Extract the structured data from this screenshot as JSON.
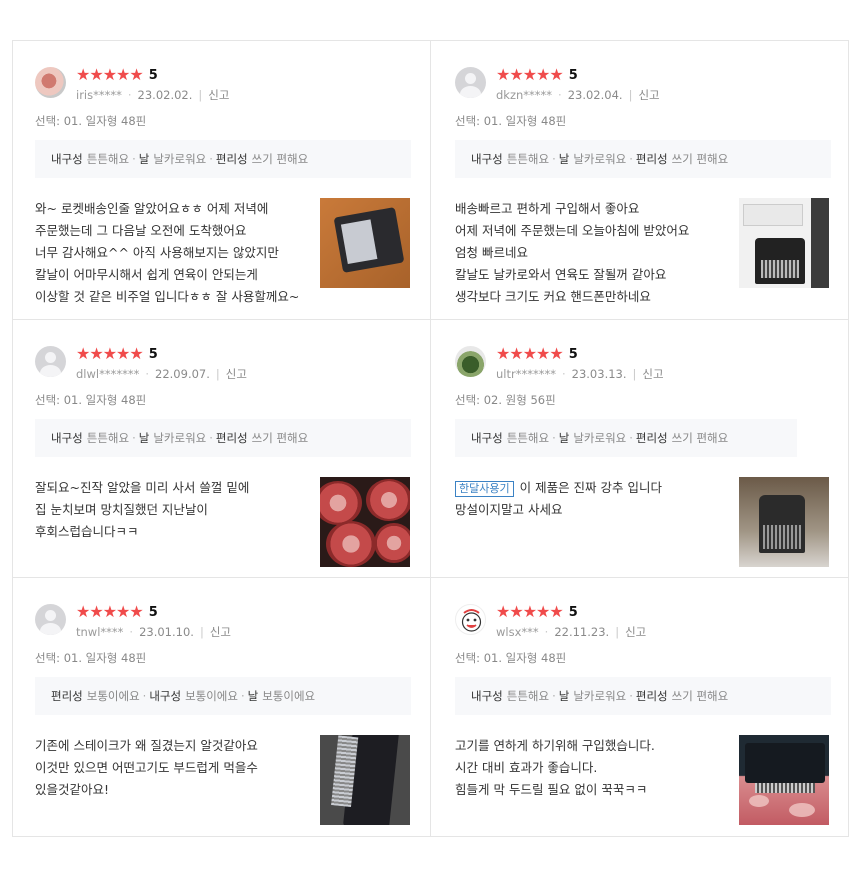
{
  "reviews": [
    {
      "avatar": "user-photo",
      "rating": 5,
      "user": "iris*****",
      "date": "23.02.02.",
      "report": "신고",
      "option": "선택: 01. 일자형 48핀",
      "tags": [
        {
          "label": "내구성",
          "value": "튼튼해요"
        },
        {
          "label": "날",
          "value": "날카로워요"
        },
        {
          "label": "편리성",
          "value": "쓰기 편해요"
        }
      ],
      "badge": null,
      "lines": [
        "와~ 로켓배송인줄 알았어요ㅎㅎ 어제 저녁에",
        "주문했는데 그 다음날 오전에 도착했어요",
        "너무 감사해요^^ 아직 사용해보지는 않았지만",
        "칼날이 어마무시해서 쉽게 연육이 안되는게",
        "이상할 것 같은 비주얼 입니다ㅎㅎ 잘 사용할께요~"
      ],
      "thumb": "meat-tenderizer-on-wood-photo"
    },
    {
      "avatar": "default-avatar",
      "rating": 5,
      "user": "dkzn*****",
      "date": "23.02.04.",
      "report": "신고",
      "option": "선택: 01. 일자형 48핀",
      "tags": [
        {
          "label": "내구성",
          "value": "튼튼해요"
        },
        {
          "label": "날",
          "value": "날카로워요"
        },
        {
          "label": "편리성",
          "value": "쓰기 편해요"
        }
      ],
      "badge": null,
      "lines": [
        "배송빠르고 편하게 구입해서 좋아요",
        "어제 저녁에 주문했는데 오늘아침에 받았어요",
        "엄청 빠르네요",
        "칼날도 날카로와서 연육도 잘될꺼 같아요",
        "생각보다 크기도 커요 핸드폰만하네요"
      ],
      "thumb": "meat-tenderizer-with-package-photo"
    },
    {
      "avatar": "default-avatar",
      "rating": 5,
      "user": "dlwl*******",
      "date": "22.09.07.",
      "report": "신고",
      "option": "선택: 01. 일자형 48핀",
      "tags": [
        {
          "label": "내구성",
          "value": "튼튼해요"
        },
        {
          "label": "날",
          "value": "날카로워요"
        },
        {
          "label": "편리성",
          "value": "쓰기 편해요"
        }
      ],
      "badge": null,
      "lines": [
        "잘되요~진작 알았을 미리 사서 쓸껄 밑에",
        "집 눈치보며 망치질했던 지난날이",
        "후회스럽습니다ㅋㅋ"
      ],
      "thumb": "raw-steak-photo"
    },
    {
      "avatar": "user-photo",
      "rating": 5,
      "user": "ultr*******",
      "date": "23.03.13.",
      "report": "신고",
      "option": "선택: 02. 원형 56핀",
      "tags": [
        {
          "label": "내구성",
          "value": "튼튼해요"
        },
        {
          "label": "날",
          "value": "날카로워요"
        },
        {
          "label": "편리성",
          "value": "쓰기 편해요"
        }
      ],
      "badge": "한달사용기",
      "lines": [
        "이 제품은 진짜 강추 입니다",
        "망설이지말고 사세요"
      ],
      "thumb": "round-tenderizer-photo"
    },
    {
      "avatar": "default-avatar",
      "rating": 5,
      "user": "tnwl****",
      "date": "23.01.10.",
      "report": "신고",
      "option": "선택: 01. 일자형 48핀",
      "tags": [
        {
          "label": "편리성",
          "value": "보통이에요"
        },
        {
          "label": "내구성",
          "value": "보통이에요"
        },
        {
          "label": "날",
          "value": "보통이에요"
        }
      ],
      "badge": null,
      "lines": [
        "기존에 스테이크가 왜 질겼는지 알것같아요",
        "이것만 있으면 어떤고기도 부드럽게 먹을수",
        "있을것같아요!"
      ],
      "thumb": "tenderizer-blades-photo"
    },
    {
      "avatar": "character-avatar",
      "rating": 5,
      "user": "wlsx***",
      "date": "22.11.23.",
      "report": "신고",
      "option": "선택: 01. 일자형 48핀",
      "tags": [
        {
          "label": "내구성",
          "value": "튼튼해요"
        },
        {
          "label": "날",
          "value": "날카로워요"
        },
        {
          "label": "편리성",
          "value": "쓰기 편해요"
        }
      ],
      "badge": null,
      "lines": [
        "고기를 연하게 하기위해 구입했습니다.",
        "시간 대비 효과가 좋습니다.",
        "힘들게 막 두드릴 필요 없이 꾹꾹ㅋㅋ"
      ],
      "thumb": "tenderizer-on-meat-photo"
    }
  ],
  "colors": {
    "star": "#f04b4b",
    "badge": "#3b82c4"
  }
}
